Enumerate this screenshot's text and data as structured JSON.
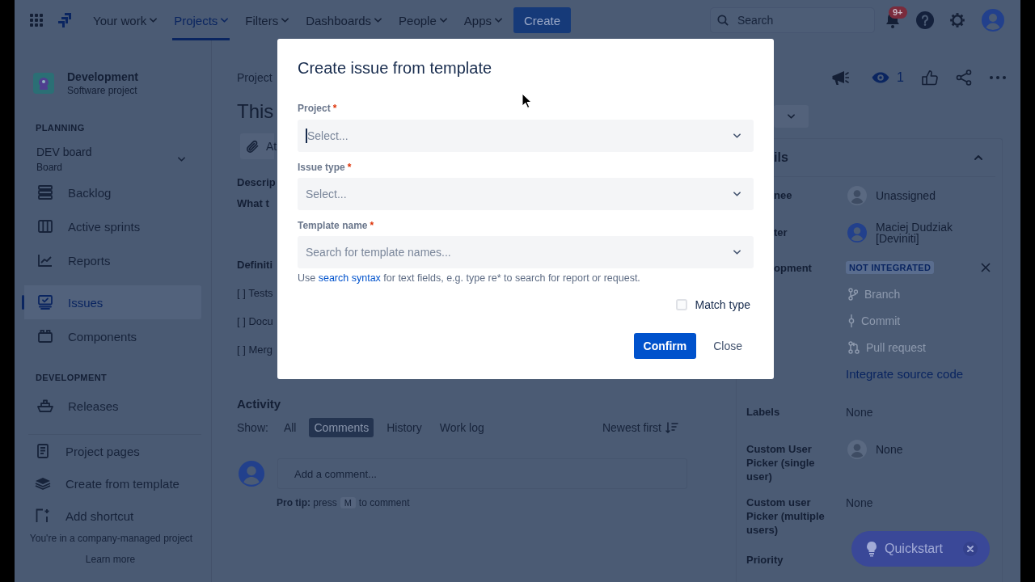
{
  "top_nav": {
    "items": [
      {
        "label": "Your work",
        "selected": false
      },
      {
        "label": "Projects",
        "selected": true
      },
      {
        "label": "Filters",
        "selected": false
      },
      {
        "label": "Dashboards",
        "selected": false
      },
      {
        "label": "People",
        "selected": false
      },
      {
        "label": "Apps",
        "selected": false
      }
    ],
    "create_button": "Create",
    "search": {
      "placeholder": "Search"
    },
    "notification_count": "9+"
  },
  "sidebar": {
    "project": {
      "name": "Development",
      "type": "Software project"
    },
    "planning": {
      "heading": "PLANNING",
      "board": {
        "name": "DEV board",
        "subtitle": "Board"
      },
      "items": [
        {
          "label": "Backlog",
          "selected": false
        },
        {
          "label": "Active sprints",
          "selected": false
        },
        {
          "label": "Reports",
          "selected": false
        },
        {
          "label": "Issues",
          "selected": true
        },
        {
          "label": "Components",
          "selected": false
        }
      ]
    },
    "development": {
      "heading": "DEVELOPMENT",
      "items": [
        {
          "label": "Releases",
          "selected": false
        }
      ]
    },
    "shortcuts": [
      {
        "label": "Project pages"
      },
      {
        "label": "Create from template"
      },
      {
        "label": "Add shortcut"
      }
    ],
    "footer": {
      "text": "You're in a company-managed project",
      "link": "Learn more"
    }
  },
  "issue": {
    "breadcrumb": "Project",
    "title": "This",
    "attach_button": "At",
    "description": {
      "heading": "Descrip",
      "text": "What t"
    },
    "definition": {
      "heading": "Definiti",
      "items": [
        "[ ] Tests",
        "[ ] Docu",
        "[ ] Merg"
      ]
    },
    "activity": {
      "heading": "Activity",
      "show_label": "Show:",
      "filters": [
        {
          "label": "All",
          "selected": false
        },
        {
          "label": "Comments",
          "selected": true
        },
        {
          "label": "History",
          "selected": false
        },
        {
          "label": "Work log",
          "selected": false
        }
      ],
      "sort": "Newest first",
      "comment": {
        "placeholder": "Add a comment..."
      },
      "tip": {
        "text": "**Pro tip:** press",
        "key": "M",
        "after": "to comment"
      }
    }
  },
  "side_panel": {
    "watchers": "1",
    "details": {
      "heading": "ils",
      "rows": [
        {
          "label": "nee",
          "kind": "empty-user",
          "value": "Unassigned"
        },
        {
          "label": "ter",
          "kind": "user",
          "value": "Maciej Dudziak [Deviniti]"
        },
        {
          "label": "opment",
          "kind": "development",
          "status": "NOT INTEGRATED",
          "links": [
            {
              "label": "Branch",
              "disabled": true
            },
            {
              "label": "Commit",
              "disabled": true
            },
            {
              "label": "Pull request",
              "disabled": true
            }
          ],
          "action": "Integrate source code"
        },
        {
          "label": "Labels",
          "kind": "text",
          "value": "None"
        },
        {
          "label": "Custom User Picker (single user)",
          "kind": "empty-user",
          "value": "None"
        },
        {
          "label": "Custom user Picker (multiple users)",
          "kind": "text",
          "value": "None"
        },
        {
          "label": "Priority",
          "kind": "text"
        }
      ]
    }
  },
  "quickstart": {
    "label": "Quickstart"
  },
  "dialog": {
    "title": "Create issue from template",
    "fields": [
      {
        "label": "Project",
        "required_mark": "*",
        "placeholder": "Select...",
        "focused": true
      },
      {
        "label": "Issue type",
        "required_mark": "*",
        "placeholder": "Select...",
        "focused": false
      },
      {
        "label": "Template name",
        "required_mark": "*",
        "placeholder": "Search for template names...",
        "focused": false
      }
    ],
    "help": {
      "before": "Use",
      "link": "search syntax",
      "after": "for text fields, e.g. type re* to search for report or request."
    },
    "match_type": {
      "label": "Match type",
      "checked": false
    },
    "buttons": [
      {
        "label": "Confirm",
        "kind": "primary"
      },
      {
        "label": "Close",
        "kind": "subtle"
      }
    ]
  }
}
